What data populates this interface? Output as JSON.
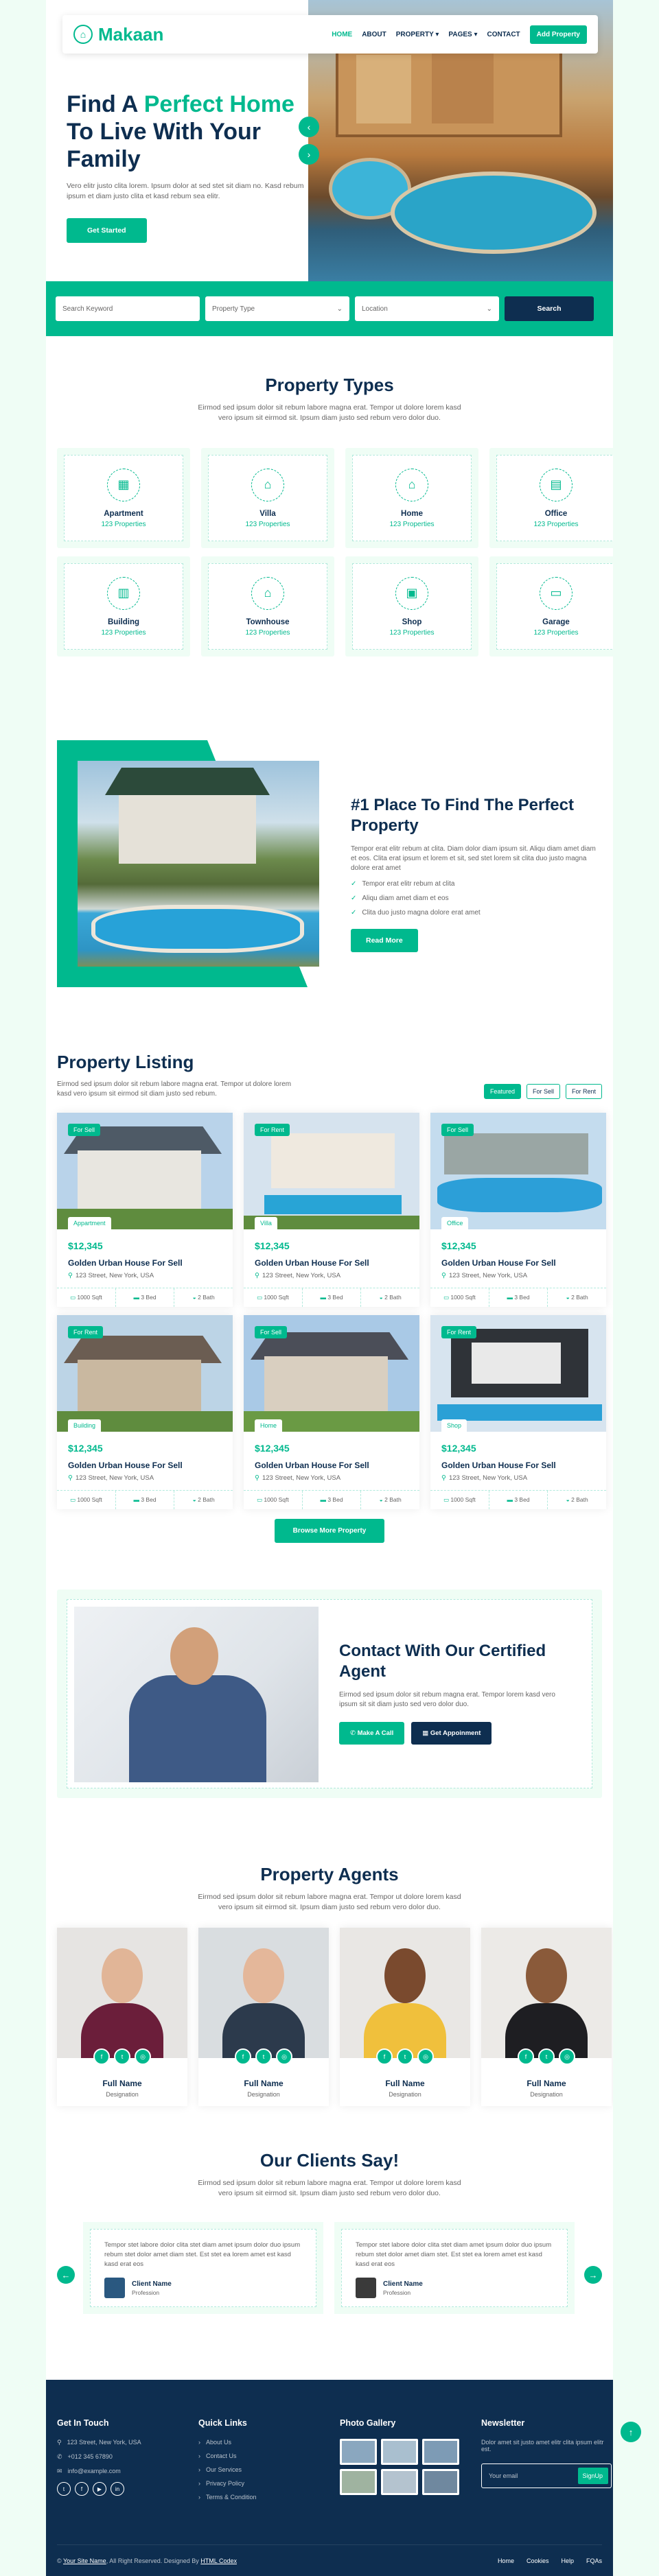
{
  "brand": {
    "name": "Makaan"
  },
  "nav": {
    "items": [
      "HOME",
      "ABOUT",
      "PROPERTY",
      "PAGES",
      "CONTACT"
    ],
    "add_property": "Add Property"
  },
  "hero": {
    "title_1": "Find A ",
    "title_highlight": "Perfect Home",
    "title_2": " To Live With Your Family",
    "text": "Vero elitr justo clita lorem. Ipsum dolor at sed stet sit diam no. Kasd rebum ipsum et diam justo clita et kasd rebum sea elitr.",
    "cta": "Get Started"
  },
  "search": {
    "keyword_placeholder": "Search Keyword",
    "type_label": "Property Type",
    "location_label": "Location",
    "button": "Search"
  },
  "types": {
    "title": "Property Types",
    "text": "Eirmod sed ipsum dolor sit rebum labore magna erat. Tempor ut dolore lorem kasd vero ipsum sit eirmod sit. Ipsum diam justo sed rebum vero dolor duo.",
    "items": [
      {
        "name": "Apartment",
        "count": "123 Properties",
        "icon": "apartment-icon"
      },
      {
        "name": "Villa",
        "count": "123 Properties",
        "icon": "villa-icon"
      },
      {
        "name": "Home",
        "count": "123 Properties",
        "icon": "home-icon"
      },
      {
        "name": "Office",
        "count": "123 Properties",
        "icon": "office-icon"
      },
      {
        "name": "Building",
        "count": "123 Properties",
        "icon": "building-icon"
      },
      {
        "name": "Townhouse",
        "count": "123 Properties",
        "icon": "townhouse-icon"
      },
      {
        "name": "Shop",
        "count": "123 Properties",
        "icon": "shop-icon"
      },
      {
        "name": "Garage",
        "count": "123 Properties",
        "icon": "garage-icon"
      }
    ]
  },
  "about": {
    "title": "#1 Place To Find The Perfect Property",
    "text": "Tempor erat elitr rebum at clita. Diam dolor diam ipsum sit. Aliqu diam amet diam et eos. Clita erat ipsum et lorem et sit, sed stet lorem sit clita duo justo magna dolore erat amet",
    "checks": [
      "Tempor erat elitr rebum at clita",
      "Aliqu diam amet diam et eos",
      "Clita duo justo magna dolore erat amet"
    ],
    "cta": "Read More"
  },
  "listing": {
    "title": "Property Listing",
    "text": "Eirmod sed ipsum dolor sit rebum labore magna erat. Tempor ut dolore lorem kasd vero ipsum sit eirmod sit diam justo sed rebum.",
    "tabs": [
      "Featured",
      "For Sell",
      "For Rent"
    ],
    "items": [
      {
        "tag": "For Sell",
        "cat": "Appartment",
        "price": "$12,345",
        "title": "Golden Urban House For Sell",
        "addr": "123 Street, New York, USA",
        "sqft": "1000 Sqft",
        "bed": "3 Bed",
        "bath": "2 Bath"
      },
      {
        "tag": "For Rent",
        "cat": "Villa",
        "price": "$12,345",
        "title": "Golden Urban House For Sell",
        "addr": "123 Street, New York, USA",
        "sqft": "1000 Sqft",
        "bed": "3 Bed",
        "bath": "2 Bath"
      },
      {
        "tag": "For Sell",
        "cat": "Office",
        "price": "$12,345",
        "title": "Golden Urban House For Sell",
        "addr": "123 Street, New York, USA",
        "sqft": "1000 Sqft",
        "bed": "3 Bed",
        "bath": "2 Bath"
      },
      {
        "tag": "For Rent",
        "cat": "Building",
        "price": "$12,345",
        "title": "Golden Urban House For Sell",
        "addr": "123 Street, New York, USA",
        "sqft": "1000 Sqft",
        "bed": "3 Bed",
        "bath": "2 Bath"
      },
      {
        "tag": "For Sell",
        "cat": "Home",
        "price": "$12,345",
        "title": "Golden Urban House For Sell",
        "addr": "123 Street, New York, USA",
        "sqft": "1000 Sqft",
        "bed": "3 Bed",
        "bath": "2 Bath"
      },
      {
        "tag": "For Rent",
        "cat": "Shop",
        "price": "$12,345",
        "title": "Golden Urban House For Sell",
        "addr": "123 Street, New York, USA",
        "sqft": "1000 Sqft",
        "bed": "3 Bed",
        "bath": "2 Bath"
      }
    ],
    "more": "Browse More Property"
  },
  "contact": {
    "title": "Contact With Our Certified Agent",
    "text": "Eirmod sed ipsum dolor sit rebum magna erat. Tempor lorem kasd vero ipsum sit sit diam justo sed vero dolor duo.",
    "call": "Make A Call",
    "appointment": "Get Appoinment"
  },
  "agents": {
    "title": "Property Agents",
    "text": "Eirmod sed ipsum dolor sit rebum labore magna erat. Tempor ut dolore lorem kasd vero ipsum sit eirmod sit. Ipsum diam justo sed rebum vero dolor duo.",
    "items": [
      {
        "name": "Full Name",
        "desg": "Designation"
      },
      {
        "name": "Full Name",
        "desg": "Designation"
      },
      {
        "name": "Full Name",
        "desg": "Designation"
      },
      {
        "name": "Full Name",
        "desg": "Designation"
      }
    ]
  },
  "testimonial": {
    "title": "Our Clients Say!",
    "text": "Eirmod sed ipsum dolor sit rebum labore magna erat. Tempor ut dolore lorem kasd vero ipsum sit eirmod sit. Ipsum diam justo sed rebum vero dolor duo.",
    "items": [
      {
        "text": "Tempor stet labore dolor clita stet diam amet ipsum dolor duo ipsum rebum stet dolor amet diam stet. Est stet ea lorem amet est kasd kasd erat eos",
        "name": "Client Name",
        "prof": "Profession"
      },
      {
        "text": "Tempor stet labore dolor clita stet diam amet ipsum dolor duo ipsum rebum stet dolor amet diam stet. Est stet ea lorem amet est kasd kasd erat eos",
        "name": "Client Name",
        "prof": "Profession"
      }
    ]
  },
  "footer": {
    "touch_title": "Get In Touch",
    "address": "123 Street, New York, USA",
    "phone": "+012 345 67890",
    "email": "info@example.com",
    "links_title": "Quick Links",
    "links": [
      "About Us",
      "Contact Us",
      "Our Services",
      "Privacy Policy",
      "Terms & Condition"
    ],
    "gallery_title": "Photo Gallery",
    "newsletter_title": "Newsletter",
    "newsletter_text": "Dolor amet sit justo amet elitr clita ipsum elitr est.",
    "email_placeholder": "Your email",
    "signup": "SignUp",
    "copy_1": "©",
    "site_name": "Your Site Name",
    "copy_2": ", All Right Reserved. Designed By",
    "designer": "HTML Codex",
    "bottom_links": [
      "Home",
      "Cookies",
      "Help",
      "FQAs"
    ]
  },
  "colors": {
    "primary": "#00b98e",
    "dark": "#0e2e50",
    "light": "#effdf5"
  }
}
